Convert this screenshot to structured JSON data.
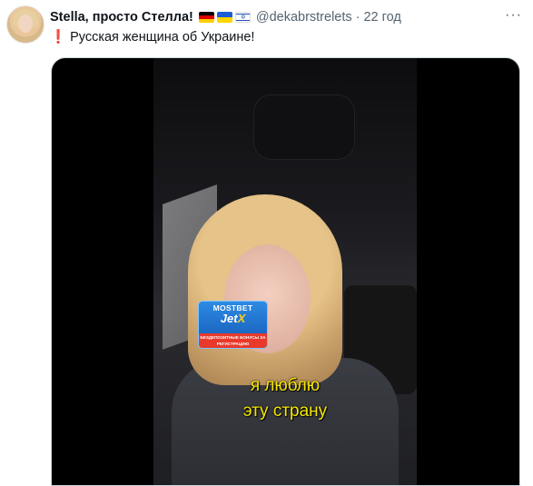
{
  "tweet": {
    "author_name": "Stella, просто Стелла!",
    "flags": [
      "germany-flag",
      "ukraine-flag",
      "israel-flag"
    ],
    "handle": "@dekabrstrelets",
    "separator": "·",
    "time": "22 год",
    "text_mark": "❗",
    "text": "Русская женщина об Украине!"
  },
  "media": {
    "ad": {
      "brand": "MOSTBET",
      "game_prefix": "Jet",
      "game_suffix": "X",
      "promo": "БЕЗДЕПОЗИТНЫЕ БОНУСЫ ЗА РЕГИСТРАЦИЮ"
    },
    "caption_line1": "я люблю",
    "caption_line2": "эту страну"
  },
  "colors": {
    "caption": "#f7e800",
    "ad_blue": "#1458b4",
    "ad_red": "#e8392b",
    "muted_text": "#536471"
  }
}
